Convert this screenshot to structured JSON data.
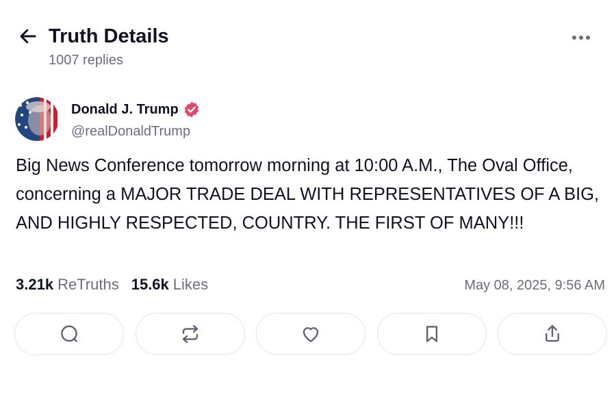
{
  "header": {
    "title": "Truth Details",
    "replies": "1007 replies",
    "back_icon": "arrow-left-icon",
    "more_icon": "more-horizontal-icon"
  },
  "author": {
    "name": "Donald J. Trump",
    "handle": "@realDonaldTrump",
    "verified_color": "#e8456b"
  },
  "post": {
    "text": "Big News Conference tomorrow morning at 10:00 A.M., The Oval Office, concerning a MAJOR TRADE DEAL WITH REPRESENTATIVES OF A BIG, AND HIGHLY RESPECTED, COUNTRY. THE FIRST OF MANY!!!",
    "retruths_count": "3.21k",
    "retruths_label": "ReTruths",
    "likes_count": "15.6k",
    "likes_label": "Likes",
    "timestamp": "May 08, 2025, 9:56 AM"
  },
  "actions": [
    {
      "icon": "reply-bubble-icon"
    },
    {
      "icon": "retruth-icon"
    },
    {
      "icon": "heart-icon"
    },
    {
      "icon": "bookmark-icon"
    },
    {
      "icon": "share-icon"
    }
  ],
  "colors": {
    "text_primary": "#0f1222",
    "text_secondary": "#6b6e7a",
    "border": "#e3e4ea"
  }
}
